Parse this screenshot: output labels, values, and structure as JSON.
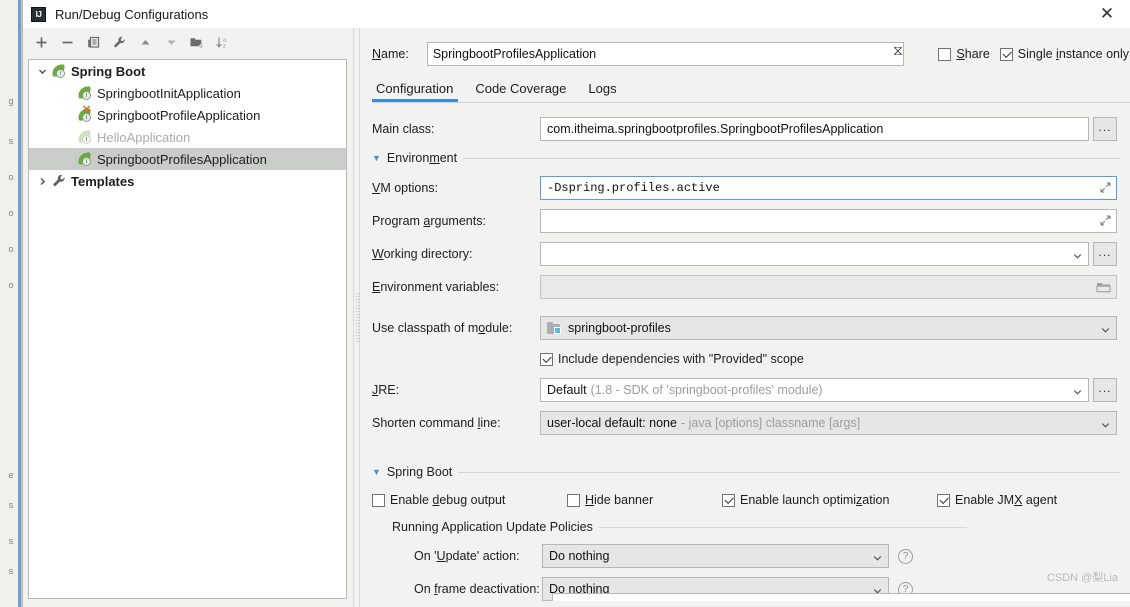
{
  "window": {
    "title": "Run/Debug Configurations",
    "app_icon": "IJ",
    "close_label": "✕"
  },
  "toolbar": {
    "buttons": [
      {
        "name": "add-configuration-button",
        "icon": "plus-icon",
        "glyph": "+"
      },
      {
        "name": "remove-configuration-button",
        "icon": "minus-icon",
        "glyph": "−"
      },
      {
        "name": "copy-configuration-button",
        "icon": "copy-icon",
        "glyph": "❐"
      },
      {
        "name": "edit-templates-button",
        "icon": "wrench-icon",
        "glyph": "🔧"
      },
      {
        "name": "move-up-button",
        "icon": "arrow-up-icon",
        "glyph": "▲"
      },
      {
        "name": "move-down-button",
        "icon": "arrow-down-icon",
        "glyph": "▼"
      },
      {
        "name": "new-folder-button",
        "icon": "folder-plus-icon",
        "glyph": "🗁"
      },
      {
        "name": "sort-configurations-button",
        "icon": "sort-alpha-icon",
        "glyph": "↓az"
      }
    ]
  },
  "tree": {
    "items": [
      {
        "label": "Spring Boot",
        "level": 0,
        "bold": true,
        "expanded": true,
        "icon": "spring-boot-icon",
        "selected": false,
        "dimmed": false,
        "error": false
      },
      {
        "label": "SpringbootInitApplication",
        "level": 1,
        "bold": false,
        "icon": "spring-boot-icon",
        "selected": false,
        "dimmed": false,
        "error": false
      },
      {
        "label": "SpringbootProfileApplication",
        "level": 1,
        "bold": false,
        "icon": "spring-boot-error-icon",
        "selected": false,
        "dimmed": false,
        "error": true
      },
      {
        "label": "HelloApplication",
        "level": 1,
        "bold": false,
        "icon": "spring-boot-icon",
        "selected": false,
        "dimmed": true,
        "error": false
      },
      {
        "label": "SpringbootProfilesApplication",
        "level": 1,
        "bold": false,
        "icon": "spring-boot-icon",
        "selected": true,
        "dimmed": false,
        "error": false
      },
      {
        "label": "Templates",
        "level": 0,
        "bold": true,
        "expanded": false,
        "icon": "wrench-icon",
        "selected": false,
        "dimmed": false,
        "error": false
      }
    ]
  },
  "name_field": {
    "label": "Name:",
    "value": "SpringbootProfilesApplication",
    "placeholder": ""
  },
  "options": {
    "share": {
      "label": "Share",
      "checked": false
    },
    "single_instance": {
      "label": "Single instance only",
      "checked": true
    }
  },
  "tabs": [
    {
      "label": "Configuration",
      "active": true
    },
    {
      "label": "Code Coverage",
      "active": false
    },
    {
      "label": "Logs",
      "active": false
    }
  ],
  "form": {
    "main_class": {
      "label": "Main class:",
      "value": "com.itheima.springbootprofiles.SpringbootProfilesApplication",
      "browse_label": "..."
    },
    "environment_section": {
      "label": "Environment",
      "expanded": true,
      "arrow": "▼"
    },
    "vm_options": {
      "label": "VM options:",
      "value": "-Dspring.profiles.active",
      "focused": true,
      "expand_icon": "expand-editor-icon"
    },
    "program_arguments": {
      "label": "Program arguments:",
      "value": "",
      "expand_icon": "expand-editor-icon"
    },
    "working_directory": {
      "label": "Working directory:",
      "value": "",
      "browse_label": "..."
    },
    "environment_variables": {
      "label": "Environment variables:",
      "value": "",
      "disabled": true,
      "browse_icon": "folder-icon"
    },
    "classpath_module": {
      "label": "Use classpath of module:",
      "value": "springboot-profiles",
      "icon": "module-icon"
    },
    "include_provided": {
      "label": "Include dependencies with \"Provided\" scope",
      "checked": true
    },
    "jre": {
      "label": "JRE:",
      "value": "Default",
      "hint": "(1.8 - SDK of 'springboot-profiles' module)",
      "browse_label": "..."
    },
    "shorten_command_line": {
      "label": "Shorten command line:",
      "value": "user-local default: none",
      "hint": "- java [options] classname [args]"
    },
    "spring_boot_section": {
      "label": "Spring Boot",
      "expanded": true,
      "arrow": "▼"
    },
    "spring_boot_checkboxes": [
      {
        "label": "Enable debug output",
        "checked": false
      },
      {
        "label": "Hide banner",
        "checked": false
      },
      {
        "label": "Enable launch optimization",
        "checked": true
      },
      {
        "label": "Enable JMX agent",
        "checked": true
      }
    ],
    "update_policies_section": {
      "label": "Running Application Update Policies"
    },
    "on_update_action": {
      "label": "On 'Update' action:",
      "value": "Do nothing",
      "help": "?"
    },
    "on_frame_deactivation": {
      "label": "On frame deactivation:",
      "value": "Do nothing",
      "help": "?"
    }
  },
  "watermark": "CSDN @梨Lia",
  "background_gutter": [
    "g",
    "s",
    "o",
    "o",
    "o",
    "o",
    "e",
    "s",
    "s",
    "s"
  ],
  "colors": {
    "accent": "#3e8ddd",
    "selection": "#c9ccc9",
    "leaf_green": "#6aaa3f",
    "error_orange": "#e06c1f",
    "focus_border": "#5b9bd8"
  }
}
